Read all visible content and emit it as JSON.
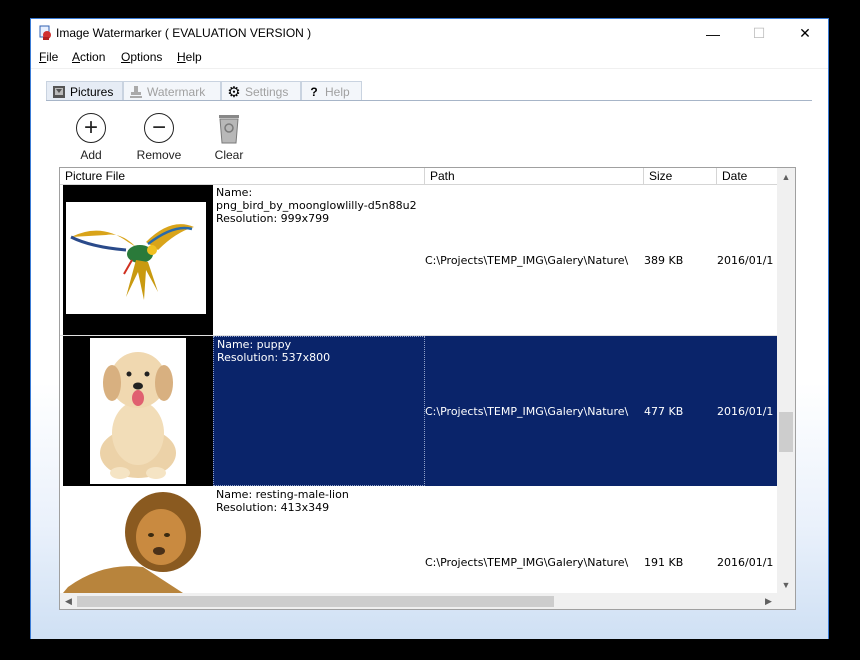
{
  "window": {
    "title": "Image Watermarker ( EVALUATION VERSION )",
    "minimize": "—",
    "maximize": "☐",
    "close": "✕"
  },
  "menu": [
    {
      "label": "File",
      "u": "F",
      "rest": "ile"
    },
    {
      "label": "Action",
      "u": "A",
      "rest": "ction"
    },
    {
      "label": "Options",
      "u": "O",
      "rest": "ptions"
    },
    {
      "label": "Help",
      "u": "H",
      "rest": "elp"
    }
  ],
  "tabs": [
    {
      "label": "Pictures",
      "active": true,
      "icon": "picture-icon"
    },
    {
      "label": "Watermark",
      "active": false,
      "icon": "stamp-icon"
    },
    {
      "label": "Settings",
      "active": false,
      "icon": "gear-icon"
    },
    {
      "label": "Help",
      "active": false,
      "icon": "question-icon"
    }
  ],
  "toolbar": {
    "add_label": "Add",
    "remove_label": "Remove",
    "clear_label": "Clear"
  },
  "grid": {
    "columns": [
      "Picture File",
      "Path",
      "Size",
      "Date"
    ],
    "rows": [
      {
        "name_line": "Name:",
        "name_value": "png_bird_by_moonglowlilly-d5n88u2",
        "resolution": "Resolution: 999x799",
        "path": "C:\\Projects\\TEMP_IMG\\Galery\\Nature\\",
        "size": "389 KB",
        "date": "2016/01/1",
        "selected": false,
        "thumb": "parrot-image"
      },
      {
        "name_line": "Name: puppy",
        "name_value": "",
        "resolution": "Resolution: 537x800",
        "path": "C:\\Projects\\TEMP_IMG\\Galery\\Nature\\",
        "size": "477 KB",
        "date": "2016/01/1",
        "selected": true,
        "thumb": "puppy-image"
      },
      {
        "name_line": "Name: resting-male-lion",
        "name_value": "",
        "resolution": "Resolution: 413x349",
        "path": "C:\\Projects\\TEMP_IMG\\Galery\\Nature\\",
        "size": "191 KB",
        "date": "2016/01/1",
        "selected": false,
        "thumb": "lion-image"
      }
    ]
  },
  "colors": {
    "selection": "#0a246a",
    "window_border": "#3a7bd5",
    "desktop": "#000000"
  }
}
